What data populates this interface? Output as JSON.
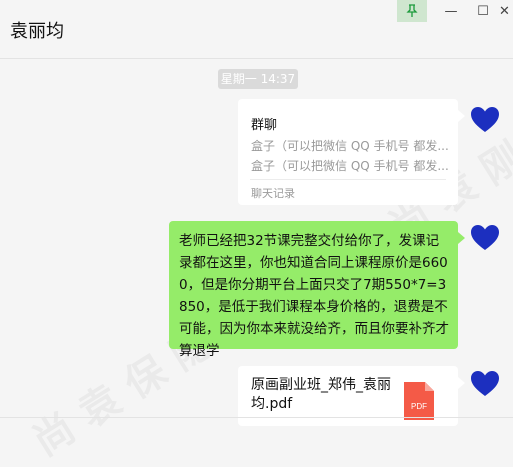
{
  "window": {
    "title": "袁丽均",
    "pin_icon": "pin-icon",
    "minimize_glyph": "—",
    "maximize_glyph": "☐",
    "close_glyph": "✕"
  },
  "conversation": {
    "timestamp": "星期一 14:37",
    "chat_record": {
      "title": "群聊",
      "line1": "盒子（可以把微信 QQ 手机号 都发...",
      "line2": "盒子（可以把微信 QQ 手机号 都发...",
      "footer": "聊天记录"
    },
    "text_message": "老师已经把32节课完整交付给你了，发课记录都在这里，你也知道合同上课程原价是6600，但是你分期平台上面只交了7期550*7=3850，是低于我们课程本身价格的，退费是不可能，因为你本来就没给齐，而且你要补齐才算退学",
    "file": {
      "name": "原画副业班_郑伟_袁丽均.pdf",
      "icon_label": "PDF"
    }
  },
  "colors": {
    "bubble_green": "#95ec69",
    "avatar_blue": "#1c2fbf",
    "pdf_red": "#f45a47"
  }
}
